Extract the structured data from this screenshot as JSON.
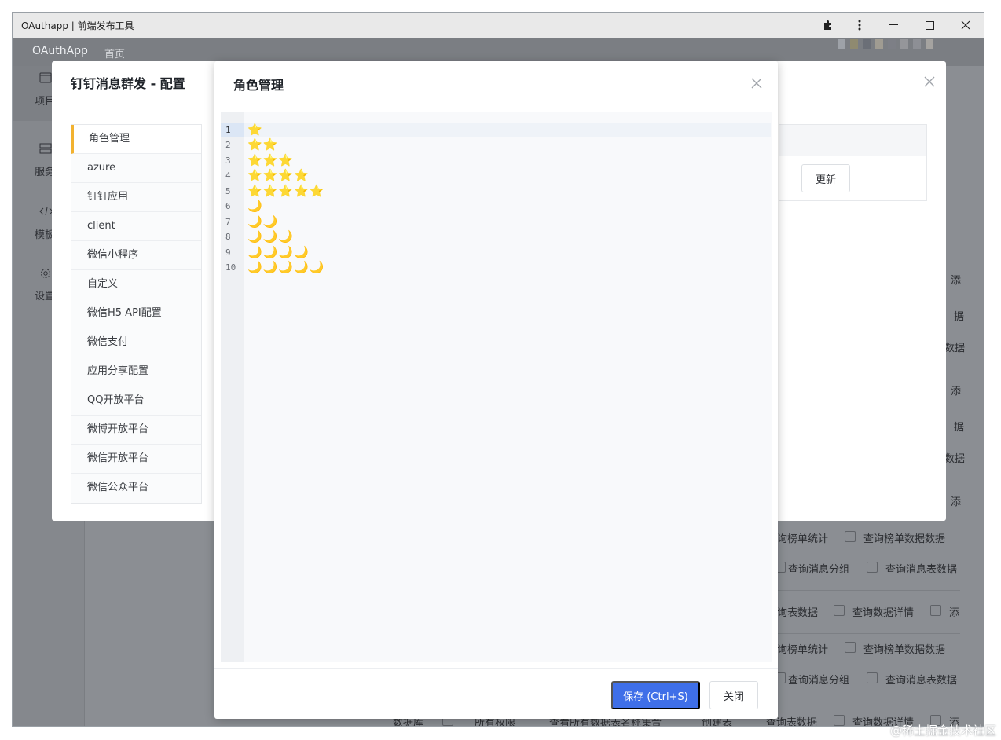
{
  "window": {
    "title": "OAuthapp | 前端发布工具"
  },
  "titlebar_icons": [
    "puzzle-icon",
    "kebab-icon",
    "minimize-icon",
    "maximize-icon",
    "close-icon"
  ],
  "appbar": {
    "brand": "OAuthApp",
    "home": "首页"
  },
  "leftnav": [
    {
      "label": "项目",
      "icon": "window-icon"
    },
    {
      "label": "服务",
      "icon": "server-icon"
    },
    {
      "label": "模板",
      "icon": "code-icon"
    },
    {
      "label": "设置",
      "icon": "gear-icon"
    }
  ],
  "dialog_config": {
    "title": "钉钉消息群发 - 配置",
    "menu": [
      "角色管理",
      "azure",
      "钉钉应用",
      "client",
      "微信小程序",
      "自定义",
      "微信H5 API配置",
      "微信支付",
      "应用分享配置",
      "QQ开放平台",
      "微博开放平台",
      "微信开放平台",
      "微信公众平台"
    ],
    "active_index": 0,
    "update_label": "更新"
  },
  "dialog_roles": {
    "title": "角色管理",
    "lines": [
      "⭐",
      "⭐⭐",
      "⭐⭐⭐",
      "⭐⭐⭐⭐",
      "⭐⭐⭐⭐⭐",
      "🌙",
      "🌙🌙",
      "🌙🌙🌙",
      "🌙🌙🌙🌙",
      "🌙🌙🌙🌙🌙"
    ],
    "line_numbers": [
      "1",
      "2",
      "3",
      "4",
      "5",
      "6",
      "7",
      "8",
      "9",
      "10"
    ],
    "active_line": 0,
    "save_label": "保存 (Ctrl+S)",
    "close_label": "关闭"
  },
  "background": {
    "fragments": [
      "添",
      "据",
      "数据",
      "添",
      "据",
      "数据",
      "添",
      "询榜单统计",
      "查询榜单数据数据",
      "查询消息分组",
      "查询消息表数据",
      "询表数据",
      "查询数据详情",
      "添",
      "询榜单统计",
      "查询榜单数据数据",
      "查询消息分组",
      "查询消息表数据",
      "数据库",
      "所有权限",
      "查看所有数据表名称集合",
      "创建表",
      "查询表数据",
      "查询数据详情",
      "添"
    ]
  },
  "watermark": "@稀土掘金技术社区"
}
